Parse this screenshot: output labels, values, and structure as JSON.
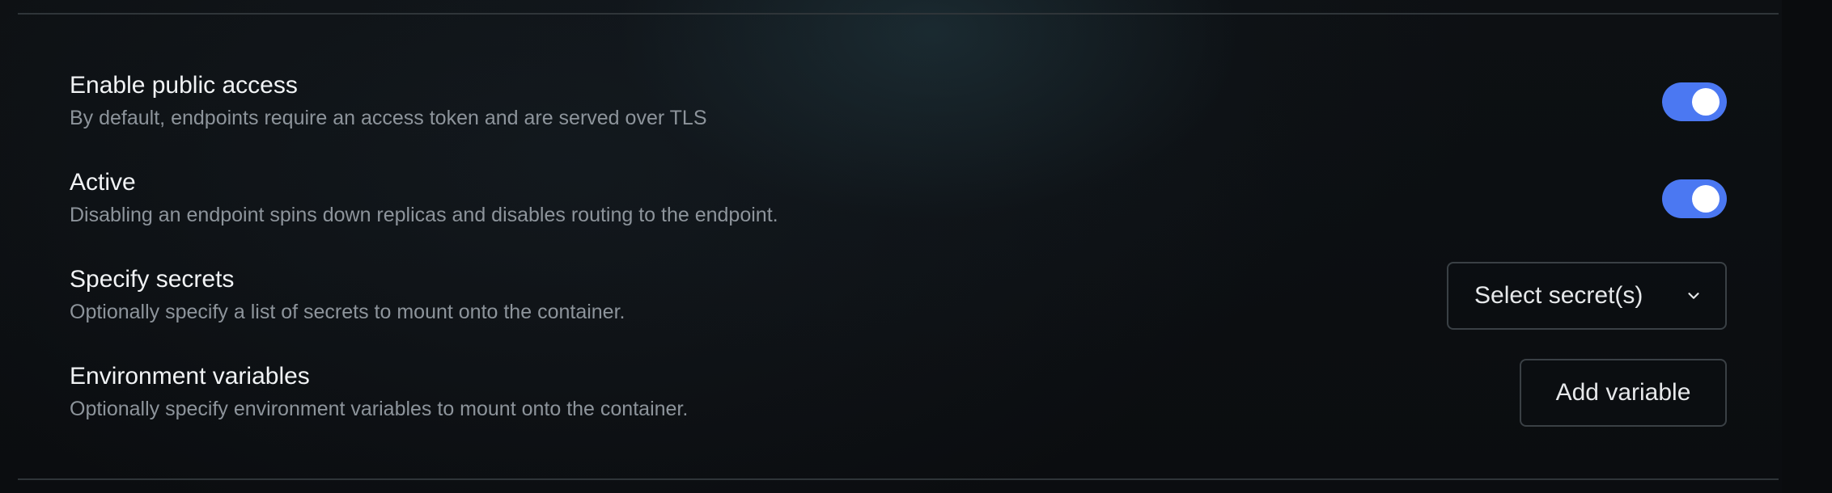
{
  "settings": [
    {
      "title": "Enable public access",
      "description": "By default, endpoints require an access token and are served over TLS",
      "control": "toggle",
      "enabled": true
    },
    {
      "title": "Active",
      "description": "Disabling an endpoint spins down replicas and disables routing to the endpoint.",
      "control": "toggle",
      "enabled": true
    },
    {
      "title": "Specify secrets",
      "description": "Optionally specify a list of secrets to mount onto the container.",
      "control": "select",
      "select_label": "Select secret(s)",
      "icon": "chevron-down-icon"
    },
    {
      "title": "Environment variables",
      "description": "Optionally specify environment variables to mount onto the container.",
      "control": "button",
      "button_label": "Add variable"
    }
  ],
  "colors": {
    "toggle_on": "#4b78f2",
    "background": "#0c0f12",
    "title_text": "#f1f3f5",
    "description_text": "#8d949b"
  }
}
